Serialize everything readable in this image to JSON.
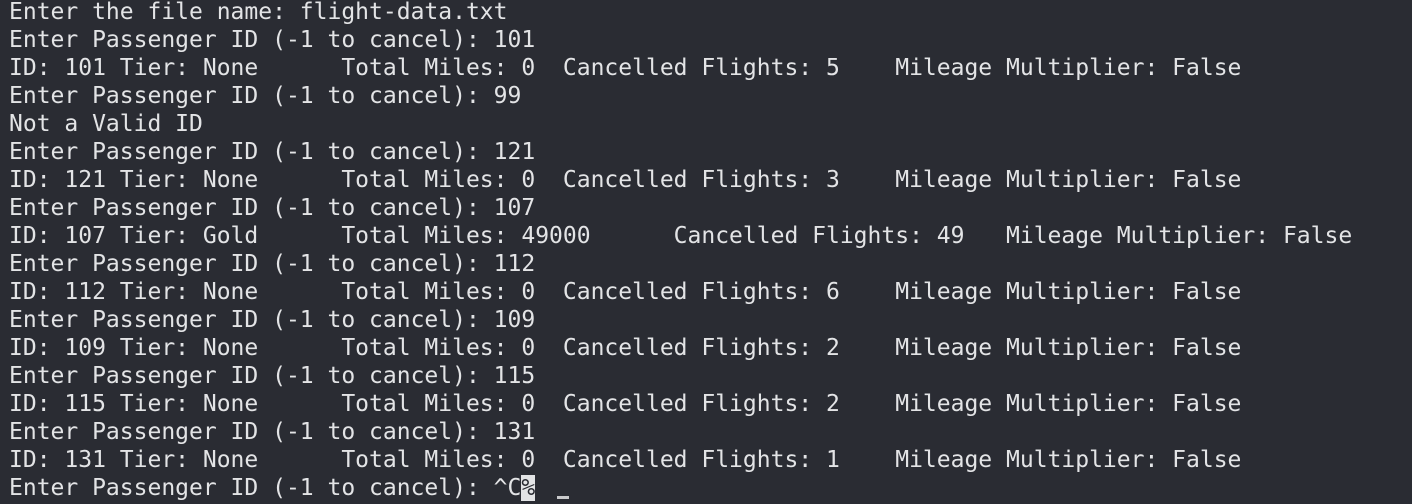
{
  "terminal": {
    "lines": [
      "Enter the file name: flight-data.txt",
      "Enter Passenger ID (-1 to cancel): 101",
      "ID: 101 Tier: None      Total Miles: 0  Cancelled Flights: 5    Mileage Multiplier: False",
      "Enter Passenger ID (-1 to cancel): 99",
      "Not a Valid ID",
      "Enter Passenger ID (-1 to cancel): 121",
      "ID: 121 Tier: None      Total Miles: 0  Cancelled Flights: 3    Mileage Multiplier: False",
      "Enter Passenger ID (-1 to cancel): 107",
      "ID: 107 Tier: Gold      Total Miles: 49000      Cancelled Flights: 49   Mileage Multiplier: False",
      "Enter Passenger ID (-1 to cancel): 112",
      "ID: 112 Tier: None      Total Miles: 0  Cancelled Flights: 6    Mileage Multiplier: False",
      "Enter Passenger ID (-1 to cancel): 109",
      "ID: 109 Tier: None      Total Miles: 0  Cancelled Flights: 2    Mileage Multiplier: False",
      "Enter Passenger ID (-1 to cancel): 115",
      "ID: 115 Tier: None      Total Miles: 0  Cancelled Flights: 2    Mileage Multiplier: False",
      "Enter Passenger ID (-1 to cancel): 131",
      "ID: 131 Tier: None      Total Miles: 0  Cancelled Flights: 1    Mileage Multiplier: False"
    ],
    "last_prompt": "Enter Passenger ID (-1 to cancel): ^C",
    "cursor_char": "%",
    "colors": {
      "background": "#2a2c33",
      "foreground": "#e3e4e6"
    }
  }
}
